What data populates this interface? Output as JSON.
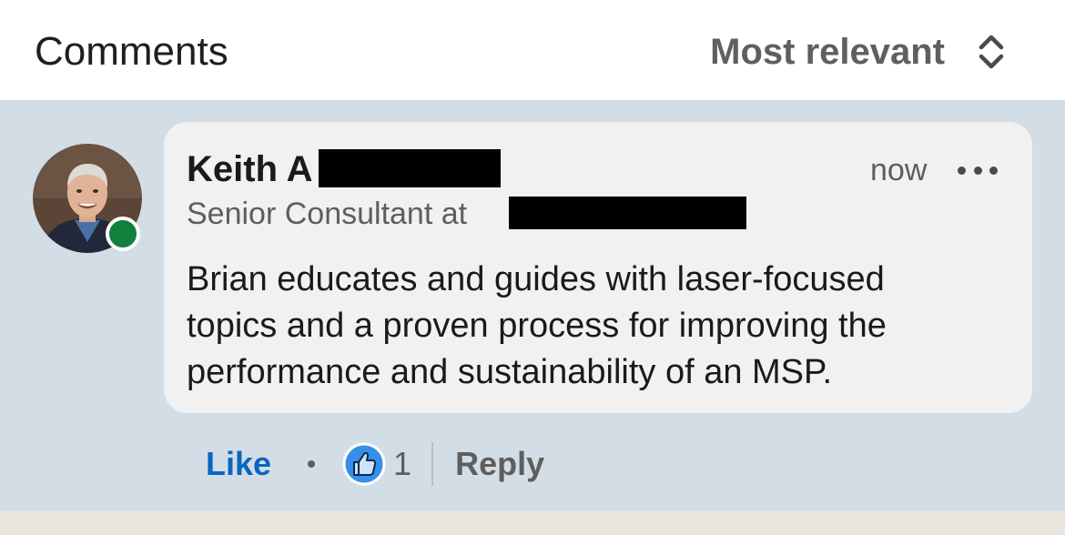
{
  "header": {
    "title": "Comments",
    "sort_label": "Most relevant",
    "sort_icon": "chevron-up-down-icon"
  },
  "comment": {
    "author_name": "Keith A",
    "author_headline": "Senior Consultant at",
    "timestamp": "now",
    "more_icon": "ellipsis-icon",
    "text": "Brian educates and guides with laser-focused\ntopics and a proven process for improving the\nperformance and sustainability of an MSP.",
    "presence_status": "online",
    "presence_color": "#127f3c",
    "actions": {
      "like_label": "Like",
      "reaction_icon": "thumbs-up-icon",
      "reaction_count": "1",
      "reply_label": "Reply"
    }
  },
  "colors": {
    "accent": "#0a66c2",
    "feed_background": "#d3dde6",
    "bubble_background": "#f1f1f1"
  }
}
